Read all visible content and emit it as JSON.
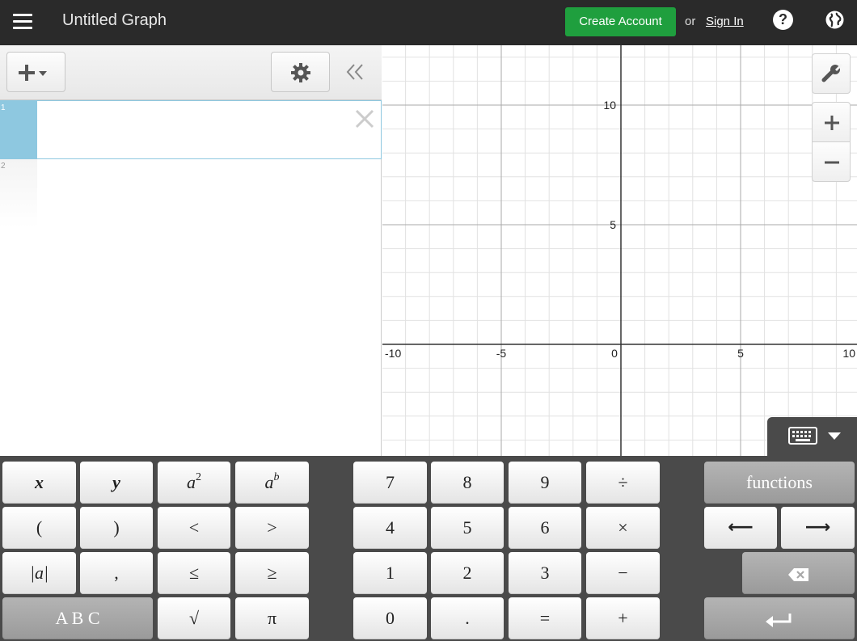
{
  "header": {
    "title": "Untitled Graph",
    "create_account": "Create Account",
    "or_text": "or",
    "sign_in": "Sign In",
    "help_glyph": "?"
  },
  "expressions": {
    "rows": [
      {
        "number": "1",
        "value": ""
      },
      {
        "number": "2",
        "value": ""
      }
    ]
  },
  "graph": {
    "x_ticks": [
      "-10",
      "-5",
      "0",
      "5",
      "10"
    ],
    "y_ticks": [
      "10",
      "5"
    ],
    "x_range": [
      -10,
      10
    ],
    "grid": true
  },
  "keypad": {
    "x": "x",
    "y": "y",
    "a_sq_base": "a",
    "a_sq_exp": "2",
    "a_pow_base": "a",
    "a_pow_exp": "b",
    "lparen": "(",
    "rparen": ")",
    "lt": "<",
    "gt": ">",
    "abs": "|a|",
    "comma": ",",
    "le": "≤",
    "ge": "≥",
    "abc": "A B C",
    "sqrt": "√",
    "pi": "π",
    "n7": "7",
    "n8": "8",
    "n9": "9",
    "div": "÷",
    "n4": "4",
    "n5": "5",
    "n6": "6",
    "mul": "×",
    "n1": "1",
    "n2": "2",
    "n3": "3",
    "minus": "−",
    "n0": "0",
    "dot": ".",
    "eq": "=",
    "plus": "+",
    "functions": "functions",
    "left_arrow": "⟵",
    "right_arrow": "⟶"
  },
  "colors": {
    "header_bg": "#2a2a2a",
    "create_button": "#1f9f3e",
    "selected_row": "#8ec8e0",
    "keypad_bg": "#4a4a4a"
  }
}
